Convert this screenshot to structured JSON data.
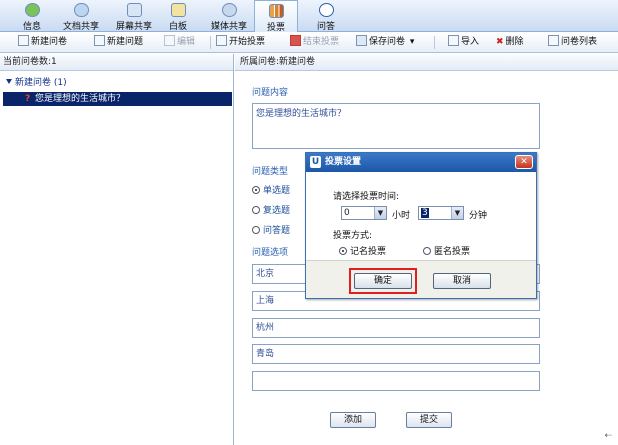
{
  "nav": [
    {
      "label": "信息",
      "icon": "info-icon",
      "color": "#5b9e3c"
    },
    {
      "label": "文档共享",
      "icon": "cloud-icon",
      "color": "#8fb6dc"
    },
    {
      "label": "屏幕共享",
      "icon": "monitor-icon",
      "color": "#6d8fbf"
    },
    {
      "label": "白板",
      "icon": "whiteboard-icon",
      "color": "#d9b63a"
    },
    {
      "label": "媒体共享",
      "icon": "media-icon",
      "color": "#7a9bbf"
    },
    {
      "label": "投票",
      "icon": "vote-chart-icon",
      "color": "#d6862a",
      "active": true
    },
    {
      "label": "问答",
      "icon": "question-icon",
      "color": "#2d5fb0"
    }
  ],
  "toolbar": {
    "new_survey": "新建问卷",
    "new_question": "新建问题",
    "edit": "编辑",
    "start_vote": "开始投票",
    "end_vote": "结束投票",
    "save_survey": "保存问卷",
    "save_arrow": "▾",
    "import": "导入",
    "delete": "删除",
    "survey_list": "问卷列表"
  },
  "left": {
    "header": "当前问卷数:1",
    "tree_root": "新建问卷 (1)",
    "tree_child": "您是理想的生活城市？"
  },
  "right": {
    "header": "所属问卷:新建问卷",
    "content_label": "问题内容",
    "content_value": "您是理想的生活城市？",
    "type_label": "问题类型",
    "types": [
      "单选题",
      "复选题",
      "问答题"
    ],
    "options_label": "问题选项",
    "options": [
      "北京",
      "上海",
      "杭州",
      "青岛",
      ""
    ],
    "add_button": "添加",
    "submit_button": "提交"
  },
  "dialog": {
    "title": "投票设置",
    "logo": "U",
    "close": "✕",
    "time_prompt": "请选择投票时间:",
    "hours_value": "0",
    "hours_unit": "小时",
    "minutes_value": "3",
    "minutes_unit": "分钟",
    "method_label": "投票方式:",
    "named": "记名投票",
    "anonymous": "匿名投票",
    "ok": "确定",
    "cancel": "取消"
  },
  "corner_mark": "⇠",
  "colors": {
    "accent": "#2a5fb0",
    "selection": "#0a246a",
    "highlight": "#e02020",
    "dialog_title": "#1d58a8"
  }
}
